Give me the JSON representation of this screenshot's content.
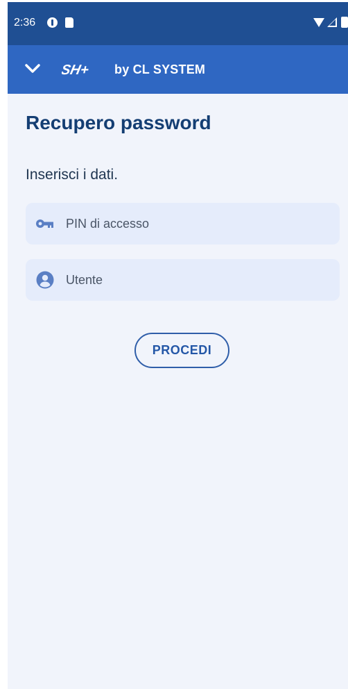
{
  "status_bar": {
    "time": "2:36",
    "icons": [
      "data-saver-icon",
      "sd-card-icon",
      "wifi-icon",
      "signal-icon",
      "battery-icon"
    ]
  },
  "app_bar": {
    "brand_logo_text": "SH+",
    "brand_text": "by CL SYSTEM",
    "collapse_icon": "chevron-down-icon",
    "color": "#2f67c2"
  },
  "page": {
    "title": "Recupero password",
    "instructions": "Inserisci i dati."
  },
  "form": {
    "pin_placeholder": "PIN di accesso",
    "pin_value": "",
    "pin_icon": "key-icon",
    "user_placeholder": "Utente",
    "user_value": "",
    "user_icon": "account-circle-icon",
    "submit_label": "PROCEDI"
  },
  "colors": {
    "status_bar": "#1f4f93",
    "background": "#f1f4fb",
    "field_background": "#e5ecfb",
    "title": "#143e73",
    "accent": "#2f5ea9"
  }
}
